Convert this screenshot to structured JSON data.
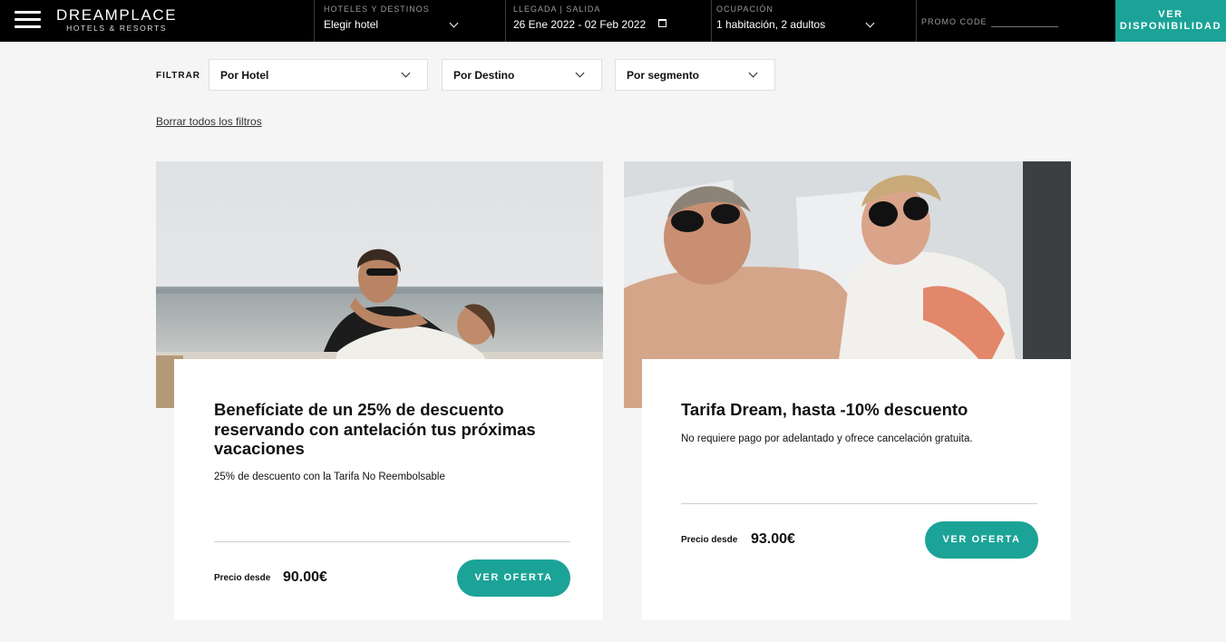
{
  "header": {
    "brand": "DREAMPLACE",
    "brand_sub": "HOTELS & RESORTS",
    "hotels_label": "HOTELES Y DESTINOS",
    "hotels_value": "Elegir hotel",
    "dates_label": "LLEGADA | SALIDA",
    "dates_value": "26 Ene 2022 - 02 Feb 2022",
    "occupancy_label": "OCUPACIÓN",
    "occupancy_value": "1 habitación, 2 adultos",
    "promo_label": "PROMO CODE",
    "promo_value": "",
    "cta_line1": "VER",
    "cta_line2": "DISPONIBILIDAD"
  },
  "filters": {
    "label": "FILTRAR",
    "by_hotel": "Por Hotel",
    "by_destination": "Por Destino",
    "by_segment": "Por segmento",
    "clear_all": "Borrar todos los filtros"
  },
  "offers": [
    {
      "title": "Benefíciate de un 25% de descuento reservando con antelación tus próximas vacaciones",
      "description": "25% de descuento con la Tarifa No Reembolsable",
      "price_from_label": "Precio desde",
      "price": "90.00€",
      "button": "VER OFERTA"
    },
    {
      "title": "Tarifa Dream, hasta -10% descuento",
      "description": "No requiere pago por adelantado y ofrece cancelación gratuita.",
      "price_from_label": "Precio desde",
      "price": "93.00€",
      "button": "VER OFERTA"
    }
  ],
  "colors": {
    "accent": "#1ba397",
    "topbar": "#000000",
    "background": "#f5f5f5"
  }
}
